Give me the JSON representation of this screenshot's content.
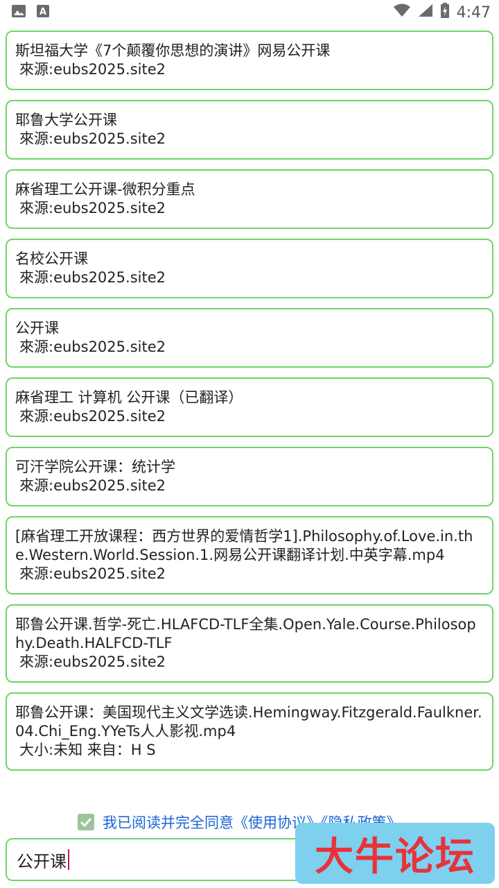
{
  "status_bar": {
    "time": "4:47"
  },
  "results": [
    {
      "title": "斯坦福大学《7个颠覆你思想的演讲》网易公开课",
      "source": "來源:eubs2025.site2"
    },
    {
      "title": "耶鲁大学公开课",
      "source": "來源:eubs2025.site2"
    },
    {
      "title": "麻省理工公开课-微积分重点",
      "source": "來源:eubs2025.site2"
    },
    {
      "title": "名校公开课",
      "source": "來源:eubs2025.site2"
    },
    {
      "title": "公开课",
      "source": "來源:eubs2025.site2"
    },
    {
      "title": "麻省理工  计算机 公开课（已翻译）",
      "source": "來源:eubs2025.site2"
    },
    {
      "title": "可汗学院公开课：统计学",
      "source": "來源:eubs2025.site2"
    },
    {
      "title": "[麻省理工开放课程：西方世界的爱情哲学1].Philosophy.of.Love.in.the.Western.World.Session.1.网易公开课翻译计划.中英字幕.mp4",
      "source": "來源:eubs2025.site2"
    },
    {
      "title": "耶鲁公开课.哲学-死亡.HLAFCD-TLF全集.Open.Yale.Course.Philosophy.Death.HALFCD-TLF",
      "source": "來源:eubs2025.site2"
    },
    {
      "title": "耶鲁公开课：美国现代主义文学选读.Hemingway.Fitzgerald.Faulkner.04.Chi_Eng.YYeTs人人影视.mp4",
      "source": "大小:未知  来自：H S"
    }
  ],
  "agreement": {
    "text": "我已阅读并完全同意《使用协议》《隐私政策》",
    "checked": true
  },
  "search": {
    "value": "公开课"
  },
  "watermark": {
    "text": "大牛论坛"
  }
}
